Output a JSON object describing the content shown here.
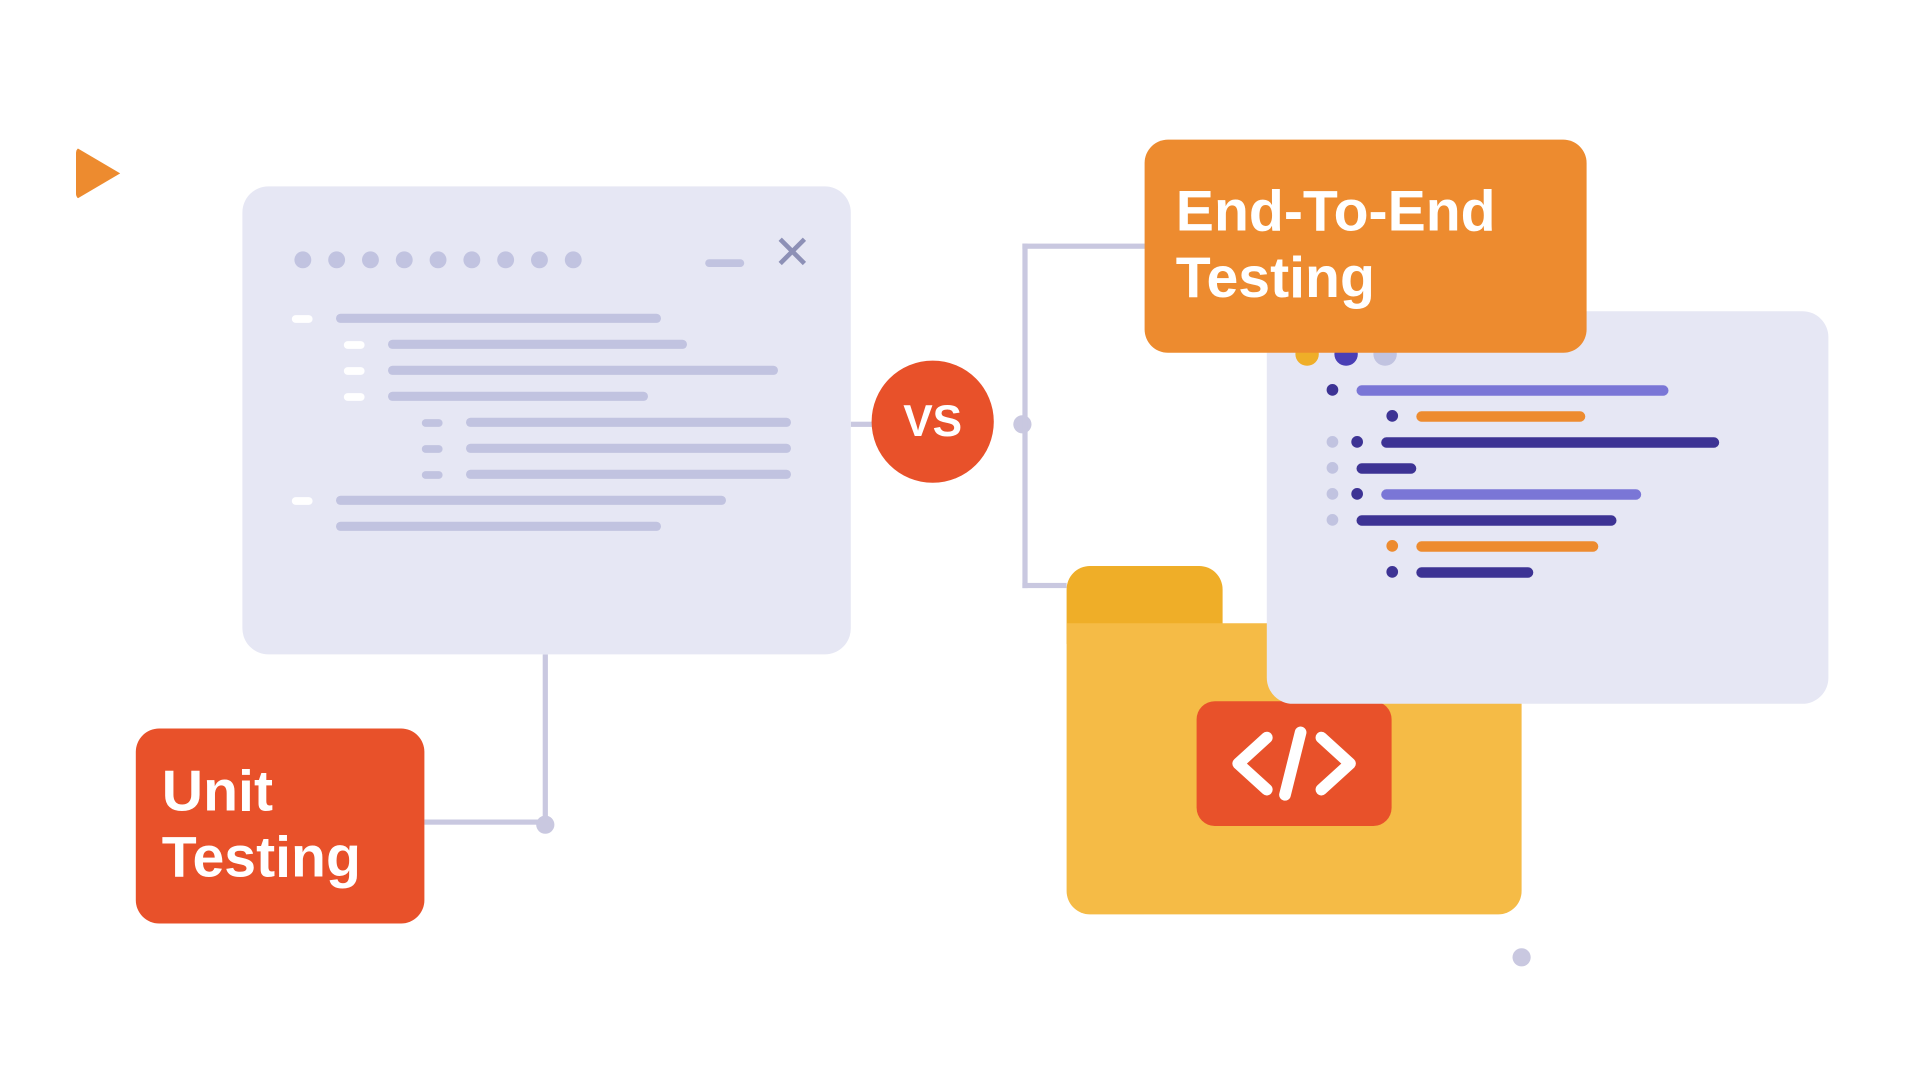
{
  "labels": {
    "unit": "Unit\nTesting",
    "e2e": "End-To-End Testing",
    "vs": "VS"
  },
  "colors": {
    "orange": "#ed8b2f",
    "red_orange": "#e8512a",
    "amber": "#f5bb46",
    "amber_dark": "#efae28",
    "navy": "#3d3394",
    "lavender_bg": "#e6e7f4",
    "lavender_line": "#c1c3e0",
    "purple": "#7a76d6"
  },
  "icons": {
    "play": "play-triangle",
    "close": "x",
    "code": "</>"
  }
}
